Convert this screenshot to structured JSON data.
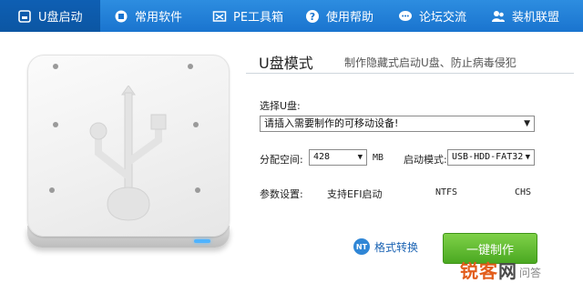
{
  "nav": {
    "items": [
      {
        "label": "U盘启动",
        "icon": "usb-drive-icon",
        "active": true
      },
      {
        "label": "常用软件",
        "icon": "software-icon",
        "active": false
      },
      {
        "label": "PE工具箱",
        "icon": "pe-toolbox-icon",
        "active": false
      },
      {
        "label": "使用帮助",
        "icon": "help-icon",
        "active": false
      },
      {
        "label": "论坛交流",
        "icon": "chat-icon",
        "active": false
      },
      {
        "label": "装机联盟",
        "icon": "people-icon",
        "active": false
      }
    ]
  },
  "mode": {
    "title": "U盘模式",
    "subtitle": "制作隐藏式启动U盘、防止病毒侵犯"
  },
  "form": {
    "select_usb_label": "选择U盘:",
    "select_usb_value": "请插入需要制作的可移动设备!",
    "partition_label": "分配空间:",
    "partition_value": "428",
    "partition_unit": "MB",
    "boot_mode_label": "启动模式:",
    "boot_mode_value": "USB-HDD-FAT32",
    "params_label": "参数设置:",
    "param_efi": "支持EFI启动",
    "param_ntfs": "NTFS",
    "param_chs": "CHS"
  },
  "actions": {
    "format_icon_text": "NT",
    "format_label": "格式转换",
    "make_label": "一键制作"
  },
  "watermark": {
    "brand_main": "锐客",
    "brand_net": "网",
    "brand_sub": "问答"
  },
  "colors": {
    "nav_bg": "#1a74cf",
    "nav_active": "#0e5fb3",
    "make_button": "#4aa821",
    "format_link": "#1b63b3"
  }
}
